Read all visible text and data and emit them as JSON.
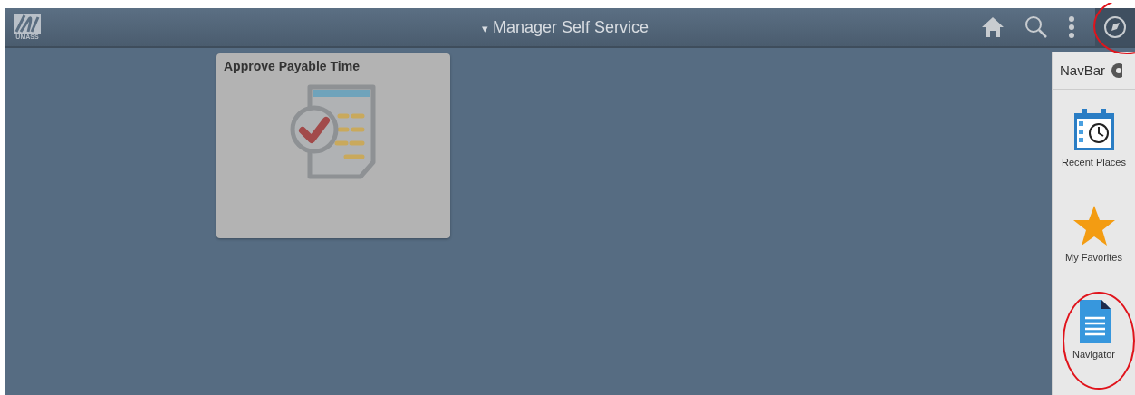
{
  "header": {
    "logo_text": "UMASS",
    "title": "Manager Self Service",
    "title_caret": "▾"
  },
  "tiles": [
    {
      "title": "Approve Payable Time"
    }
  ],
  "navbar": {
    "title": "NavBar",
    "items": [
      {
        "kind": "recent",
        "label": "Recent Places"
      },
      {
        "kind": "favorites",
        "label": "My Favorites"
      },
      {
        "kind": "navigator",
        "label": "Navigator"
      }
    ]
  }
}
